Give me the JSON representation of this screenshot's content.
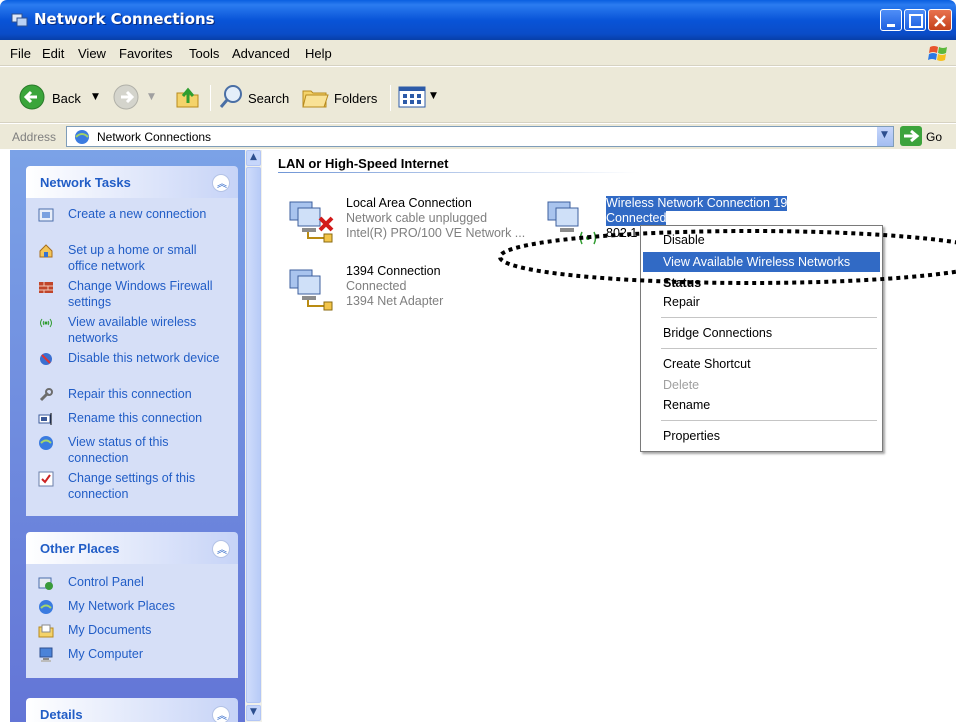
{
  "window": {
    "title": "Network Connections"
  },
  "menubar": {
    "items": [
      "File",
      "Edit",
      "View",
      "Favorites",
      "Tools",
      "Advanced",
      "Help"
    ]
  },
  "toolbar": {
    "back_label": "Back",
    "search_label": "Search",
    "folders_label": "Folders"
  },
  "address": {
    "label": "Address",
    "value": "Network Connections",
    "go_label": "Go"
  },
  "left_pane": {
    "network_tasks": {
      "title": "Network Tasks",
      "items": [
        {
          "label": "Create a new connection",
          "icon": "new-connection-icon"
        },
        {
          "label": "Set up a home or small office network",
          "icon": "home-network-icon"
        },
        {
          "label": "Change Windows Firewall settings",
          "icon": "firewall-icon"
        },
        {
          "label": "View available wireless networks",
          "icon": "wireless-icon"
        },
        {
          "label": "Disable this network device",
          "icon": "disable-device-icon"
        },
        {
          "label": "Repair this connection",
          "icon": "repair-icon"
        },
        {
          "label": "Rename this connection",
          "icon": "rename-icon"
        },
        {
          "label": "View status of this connection",
          "icon": "status-icon"
        },
        {
          "label": "Change settings of this connection",
          "icon": "settings-icon"
        }
      ]
    },
    "other_places": {
      "title": "Other Places",
      "items": [
        {
          "label": "Control Panel",
          "icon": "control-panel-icon"
        },
        {
          "label": "My Network Places",
          "icon": "network-places-icon"
        },
        {
          "label": "My Documents",
          "icon": "documents-icon"
        },
        {
          "label": "My Computer",
          "icon": "computer-icon"
        }
      ]
    },
    "details": {
      "title": "Details"
    }
  },
  "content": {
    "group_title": "LAN or High-Speed Internet",
    "connections": [
      {
        "name": "Local Area Connection",
        "status": "Network cable unplugged",
        "device": "Intel(R) PRO/100 VE Network ..."
      },
      {
        "name": "Wireless Network Connection 19",
        "status": "Connected",
        "device": "802.1"
      },
      {
        "name": "1394 Connection",
        "status": "Connected",
        "device": "1394 Net Adapter"
      }
    ]
  },
  "context_menu": {
    "items": [
      {
        "label": "Disable"
      },
      {
        "label": "View Available Wireless Networks",
        "highlighted": true
      },
      {
        "label": "Status"
      },
      {
        "label": "Repair"
      },
      {
        "label": "Bridge Connections"
      },
      {
        "label": "Create Shortcut"
      },
      {
        "label": "Delete",
        "disabled": true
      },
      {
        "label": "Rename"
      },
      {
        "label": "Properties"
      }
    ]
  },
  "colors": {
    "titlebar": "#0a4cc7",
    "selection": "#316ac5",
    "task_link": "#215dc6",
    "pane_bg": "#7ba2e7"
  }
}
